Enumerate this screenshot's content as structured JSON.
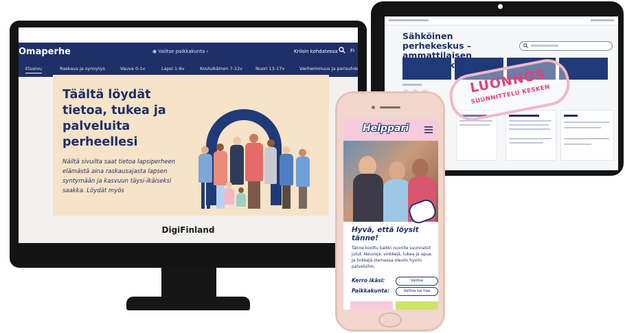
{
  "desktop": {
    "brand": "Omaperhe",
    "location_select": "Valitse paikkakunta",
    "crisis_link": "Kriisin kohdatessa",
    "language": "FI",
    "nav": [
      "Etusivu",
      "Raskaus ja synnytys",
      "Vauva 0-1v",
      "Lapsi 1-6v",
      "Kouluikäinen 7-12v",
      "Nuori 13-17v",
      "Vanhemmuus ja parisuhde"
    ],
    "hero_title": "Täältä löydät tietoa, tukea ja palveluita perheellesi",
    "hero_text": "Näiltä sivuilta saat tietoa lapsiperheen elämästä aina raskausajasta lapsen syntymään ja kasvuun täysi-ikäiseksi saakka. Löydät myös",
    "footer_logo": "DigiFinland"
  },
  "tablet": {
    "title": "Sähköinen perhekeskus – ammattilaisen tietopankki",
    "stamp_line1": "LUONNOS",
    "stamp_line2": "SUUNNITTELU KESKEN"
  },
  "phone": {
    "brand": "Helppari",
    "heading": "Hyvä, että löysit tänne!",
    "body_text": "Tänne koottu kaikki nuorille suunnatut jutut. Neuvoja, vinkkejä, tukea ja apua. Ja linkkejä olemassa oleviin hyviin palveluihin.",
    "age_label": "Kerro ikäsi:",
    "age_select": "Valitse",
    "city_label": "Paikkakunta:",
    "city_select": "Valitse tai hae"
  },
  "colors": {
    "navy": "#1f2f67",
    "cream": "#f6e3c8",
    "pink": "#f7cbdc",
    "stamp": "#e2417a",
    "lime": "#cfe36a"
  }
}
